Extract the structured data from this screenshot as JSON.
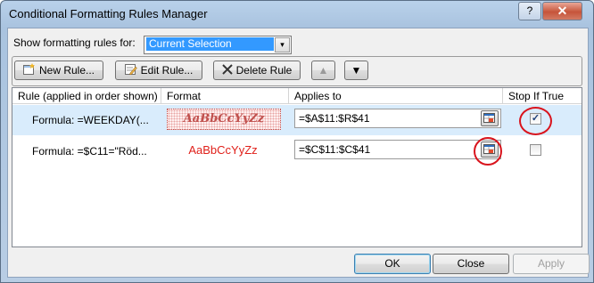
{
  "window": {
    "title": "Conditional Formatting Rules Manager",
    "help_label": "?",
    "close_label": "✕"
  },
  "filter": {
    "label": "Show formatting rules for:",
    "selected": "Current Selection",
    "arrow": "▾"
  },
  "toolbar": {
    "new_rule": "New Rule...",
    "edit_rule": "Edit Rule...",
    "delete_rule": "Delete Rule",
    "up": "▲",
    "down": "▼"
  },
  "table": {
    "headers": {
      "rule": "Rule (applied in order shown)",
      "format": "Format",
      "applies_to": "Applies to",
      "stop_if_true": "Stop If True"
    },
    "rows": [
      {
        "rule": "Formula: =WEEKDAY(...",
        "format_preview": "AaBbCcYyZz",
        "applies_to": "=$A$11:$R$41",
        "stop_if_true": true
      },
      {
        "rule": "Formula: =$C11=\"Röd...",
        "format_preview": "AaBbCcYyZz",
        "applies_to": "=$C$11:$C$41",
        "stop_if_true": false
      }
    ]
  },
  "footer": {
    "ok": "OK",
    "close": "Close",
    "apply": "Apply"
  },
  "colors": {
    "selection": "#3399ff",
    "row_highlight": "#d9ecfc",
    "annotation_circle": "#d9141d",
    "format1_text": "#c0504d",
    "format2_text": "#e0201a"
  }
}
